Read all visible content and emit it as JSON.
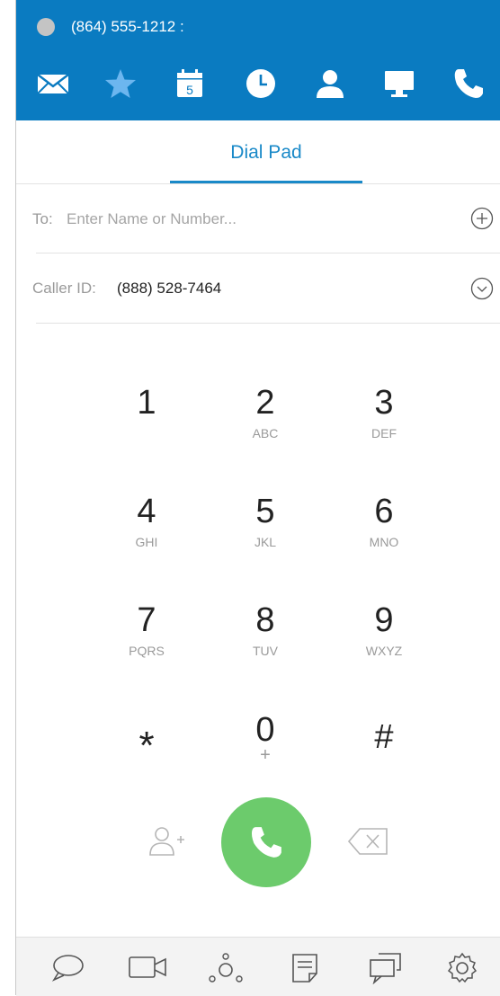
{
  "header": {
    "phone_number": "(864) 555-1212 :",
    "icons": [
      "mail-icon",
      "star-icon",
      "calendar-icon",
      "clock-icon",
      "contact-icon",
      "monitor-icon",
      "phone-icon"
    ],
    "calendar_day": "5",
    "background_color": "#0a7bc1",
    "status_color": "#c4c4c4"
  },
  "tabs": [
    {
      "label": "Dial Pad",
      "active": true
    }
  ],
  "to_field": {
    "label": "To:",
    "placeholder": "Enter Name or Number...",
    "value": ""
  },
  "caller_id": {
    "label": "Caller ID:",
    "value": "(888) 528-7464"
  },
  "keypad": [
    {
      "digit": "1",
      "letters": ""
    },
    {
      "digit": "2",
      "letters": "ABC"
    },
    {
      "digit": "3",
      "letters": "DEF"
    },
    {
      "digit": "4",
      "letters": "GHI"
    },
    {
      "digit": "5",
      "letters": "JKL"
    },
    {
      "digit": "6",
      "letters": "MNO"
    },
    {
      "digit": "7",
      "letters": "PQRS"
    },
    {
      "digit": "8",
      "letters": "TUV"
    },
    {
      "digit": "9",
      "letters": "WXYZ"
    },
    {
      "digit": "*",
      "letters": ""
    },
    {
      "digit": "0",
      "letters": "+"
    },
    {
      "digit": "#",
      "letters": ""
    }
  ],
  "actions": {
    "call_color": "#6ccb6c",
    "icons": [
      "add-contact-icon",
      "phone-icon",
      "backspace-icon"
    ]
  },
  "bottom_toolbar": {
    "icons": [
      "chat-bubble-icon",
      "video-camera-icon",
      "conference-icon",
      "notes-icon",
      "messages-icon",
      "settings-gear-icon"
    ]
  }
}
